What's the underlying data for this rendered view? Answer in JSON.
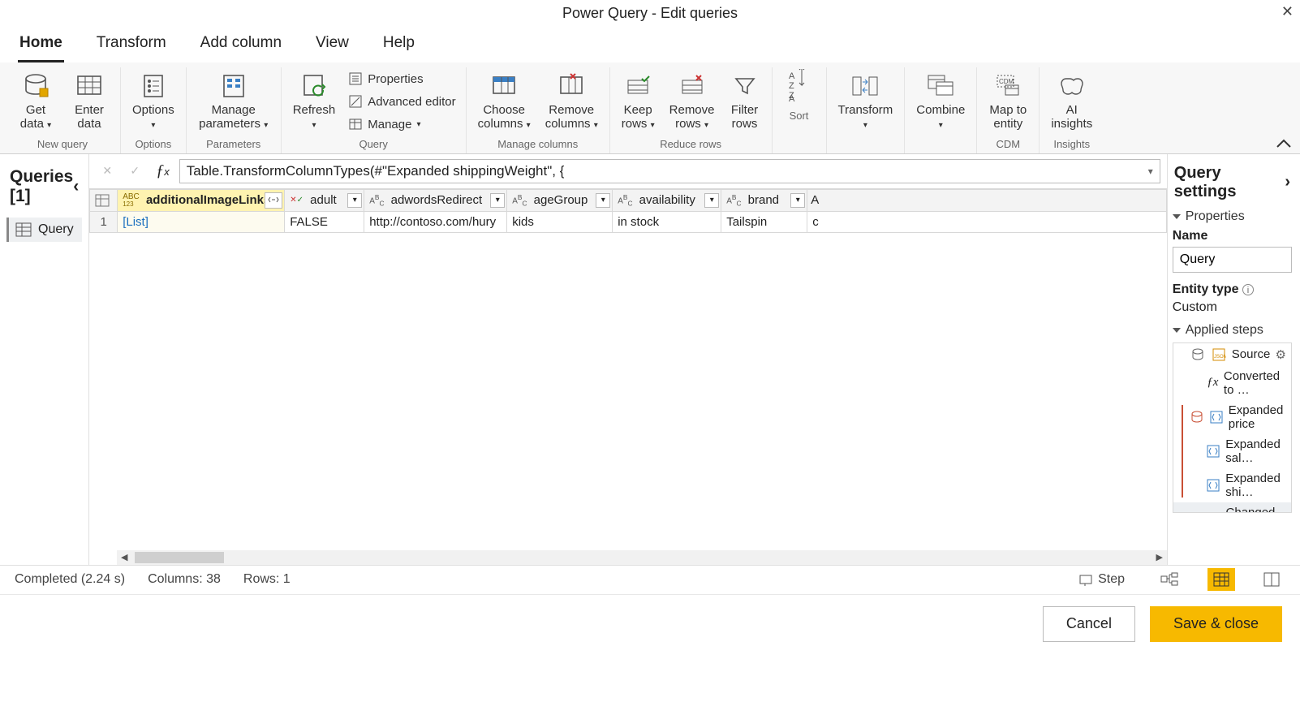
{
  "window": {
    "title": "Power Query - Edit queries"
  },
  "tabs": [
    "Home",
    "Transform",
    "Add column",
    "View",
    "Help"
  ],
  "active_tab": "Home",
  "ribbon": {
    "groups": [
      {
        "label": "New query",
        "buttons": [
          {
            "label": "Get\ndata",
            "caret": true
          },
          {
            "label": "Enter\ndata"
          }
        ]
      },
      {
        "label": "Options",
        "buttons": [
          {
            "label": "Options",
            "caret": true
          }
        ]
      },
      {
        "label": "Parameters",
        "buttons": [
          {
            "label": "Manage\nparameters",
            "caret": true
          }
        ]
      },
      {
        "label": "Query",
        "buttons_large": [
          {
            "label": "Refresh",
            "caret": true
          }
        ],
        "buttons_small": [
          {
            "label": "Properties"
          },
          {
            "label": "Advanced editor"
          },
          {
            "label": "Manage",
            "caret": true
          }
        ]
      },
      {
        "label": "Manage columns",
        "buttons": [
          {
            "label": "Choose\ncolumns",
            "caret": true
          },
          {
            "label": "Remove\ncolumns",
            "caret": true
          }
        ]
      },
      {
        "label": "Reduce rows",
        "buttons": [
          {
            "label": "Keep\nrows",
            "caret": true
          },
          {
            "label": "Remove\nrows",
            "caret": true
          },
          {
            "label": "Filter\nrows"
          }
        ]
      },
      {
        "label": "Sort",
        "buttons": [
          {
            "label": ""
          }
        ]
      },
      {
        "label": "",
        "buttons": [
          {
            "label": "Transform",
            "caret": true
          }
        ]
      },
      {
        "label": "",
        "buttons": [
          {
            "label": "Combine",
            "caret": true
          }
        ]
      },
      {
        "label": "CDM",
        "buttons": [
          {
            "label": "Map to\nentity"
          }
        ]
      },
      {
        "label": "Insights",
        "buttons": [
          {
            "label": "AI\ninsights"
          }
        ]
      }
    ]
  },
  "queries_pane": {
    "title": "Queries [1]",
    "items": [
      {
        "name": "Query"
      }
    ]
  },
  "formula": "Table.TransformColumnTypes(#\"Expanded shippingWeight\", {",
  "columns": [
    {
      "name": "additionalImageLinks",
      "type": "ABC123",
      "selected": true,
      "expand": true
    },
    {
      "name": "adult",
      "type": "X",
      "filter": true
    },
    {
      "name": "adwordsRedirect",
      "type": "ABC",
      "filter": true
    },
    {
      "name": "ageGroup",
      "type": "ABC",
      "filter": true
    },
    {
      "name": "availability",
      "type": "ABC",
      "filter": true
    },
    {
      "name": "brand",
      "type": "ABC",
      "filter": true
    }
  ],
  "rows": [
    {
      "n": 1,
      "cells": [
        "[List]",
        "FALSE",
        "http://contoso.com/hury",
        "kids",
        "in stock",
        "Tailspin"
      ]
    }
  ],
  "settings": {
    "title": "Query settings",
    "properties_label": "Properties",
    "name_label": "Name",
    "name_value": "Query",
    "entity_type_label": "Entity type",
    "entity_type_value": "Custom",
    "applied_steps_label": "Applied steps",
    "steps": [
      {
        "label": "Source",
        "gear": true
      },
      {
        "label": "Converted to …"
      },
      {
        "label": "Expanded price"
      },
      {
        "label": "Expanded sal…"
      },
      {
        "label": "Expanded shi…"
      },
      {
        "label": "Changed colu…",
        "selected": true,
        "delete": true
      }
    ]
  },
  "status": {
    "completed": "Completed (2.24 s)",
    "columns": "Columns: 38",
    "rows": "Rows: 1",
    "step_label": "Step"
  },
  "footer": {
    "cancel": "Cancel",
    "save": "Save & close"
  }
}
